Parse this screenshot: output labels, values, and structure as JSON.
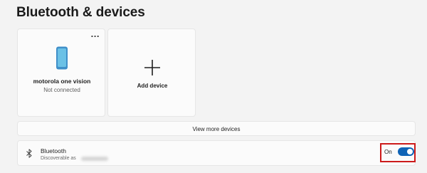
{
  "page": {
    "title": "Bluetooth & devices"
  },
  "devices": [
    {
      "name": "motorola one vision",
      "status": "Not connected",
      "icon": "phone-icon",
      "more_label": "..."
    }
  ],
  "add_device": {
    "label": "Add device",
    "icon": "plus-icon"
  },
  "view_more": {
    "label": "View more devices"
  },
  "bluetooth": {
    "title": "Bluetooth",
    "subtitle": "Discoverable as",
    "state_label": "On",
    "enabled": true,
    "icon": "bluetooth-icon"
  },
  "colors": {
    "accent": "#0f63b6",
    "highlight": "#cc1a1a",
    "background": "#f3f3f3",
    "card": "#fbfbfb"
  }
}
